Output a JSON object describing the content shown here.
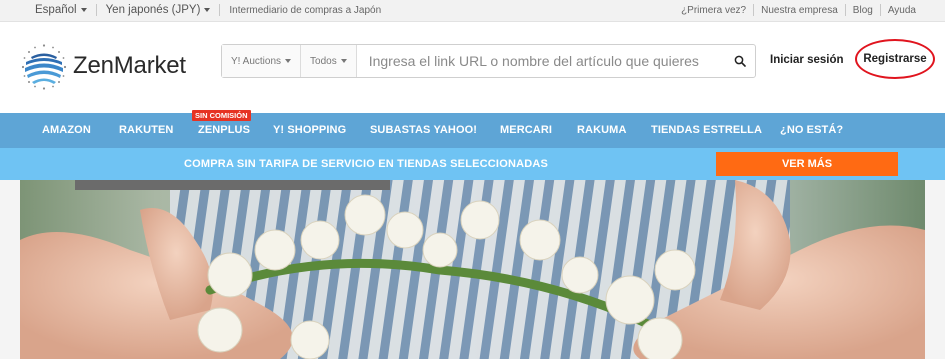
{
  "topbar": {
    "language": "Español",
    "currency": "Yen japonés (JPY)",
    "tagline": "Intermediario de compras a Japón",
    "links": [
      "¿Primera vez?",
      "Nuestra empresa",
      "Blog",
      "Ayuda"
    ]
  },
  "header": {
    "brand": "ZenMarket",
    "search": {
      "source": "Y! Auctions",
      "category": "Todos",
      "placeholder": "Ingresa el link URL o nombre del artículo que quieres"
    },
    "login": "Iniciar sesión",
    "register": "Registrarse"
  },
  "nav": {
    "items": [
      "AMAZON",
      "RAKUTEN",
      "ZENPLUS",
      "Y! SHOPPING",
      "SUBASTAS YAHOO!",
      "MERCARI",
      "RAKUMA",
      "TIENDAS ESTRELLA",
      "¿NO ESTÁ?"
    ],
    "badge": "SIN COMISIÓN"
  },
  "promo": {
    "text": "COMPRA SIN TARIFA DE SERVICIO EN TIENDAS SELECCIONADAS",
    "button": "VER MÁS"
  },
  "colors": {
    "nav_bg": "#5ea5d6",
    "promo_bg": "#6fc3f3",
    "cta": "#ff6a13",
    "badge": "#e63323",
    "register_ring": "#e0141e"
  },
  "icons": [
    "zenmarket-logo-icon",
    "search-icon",
    "caret-down-icon"
  ]
}
